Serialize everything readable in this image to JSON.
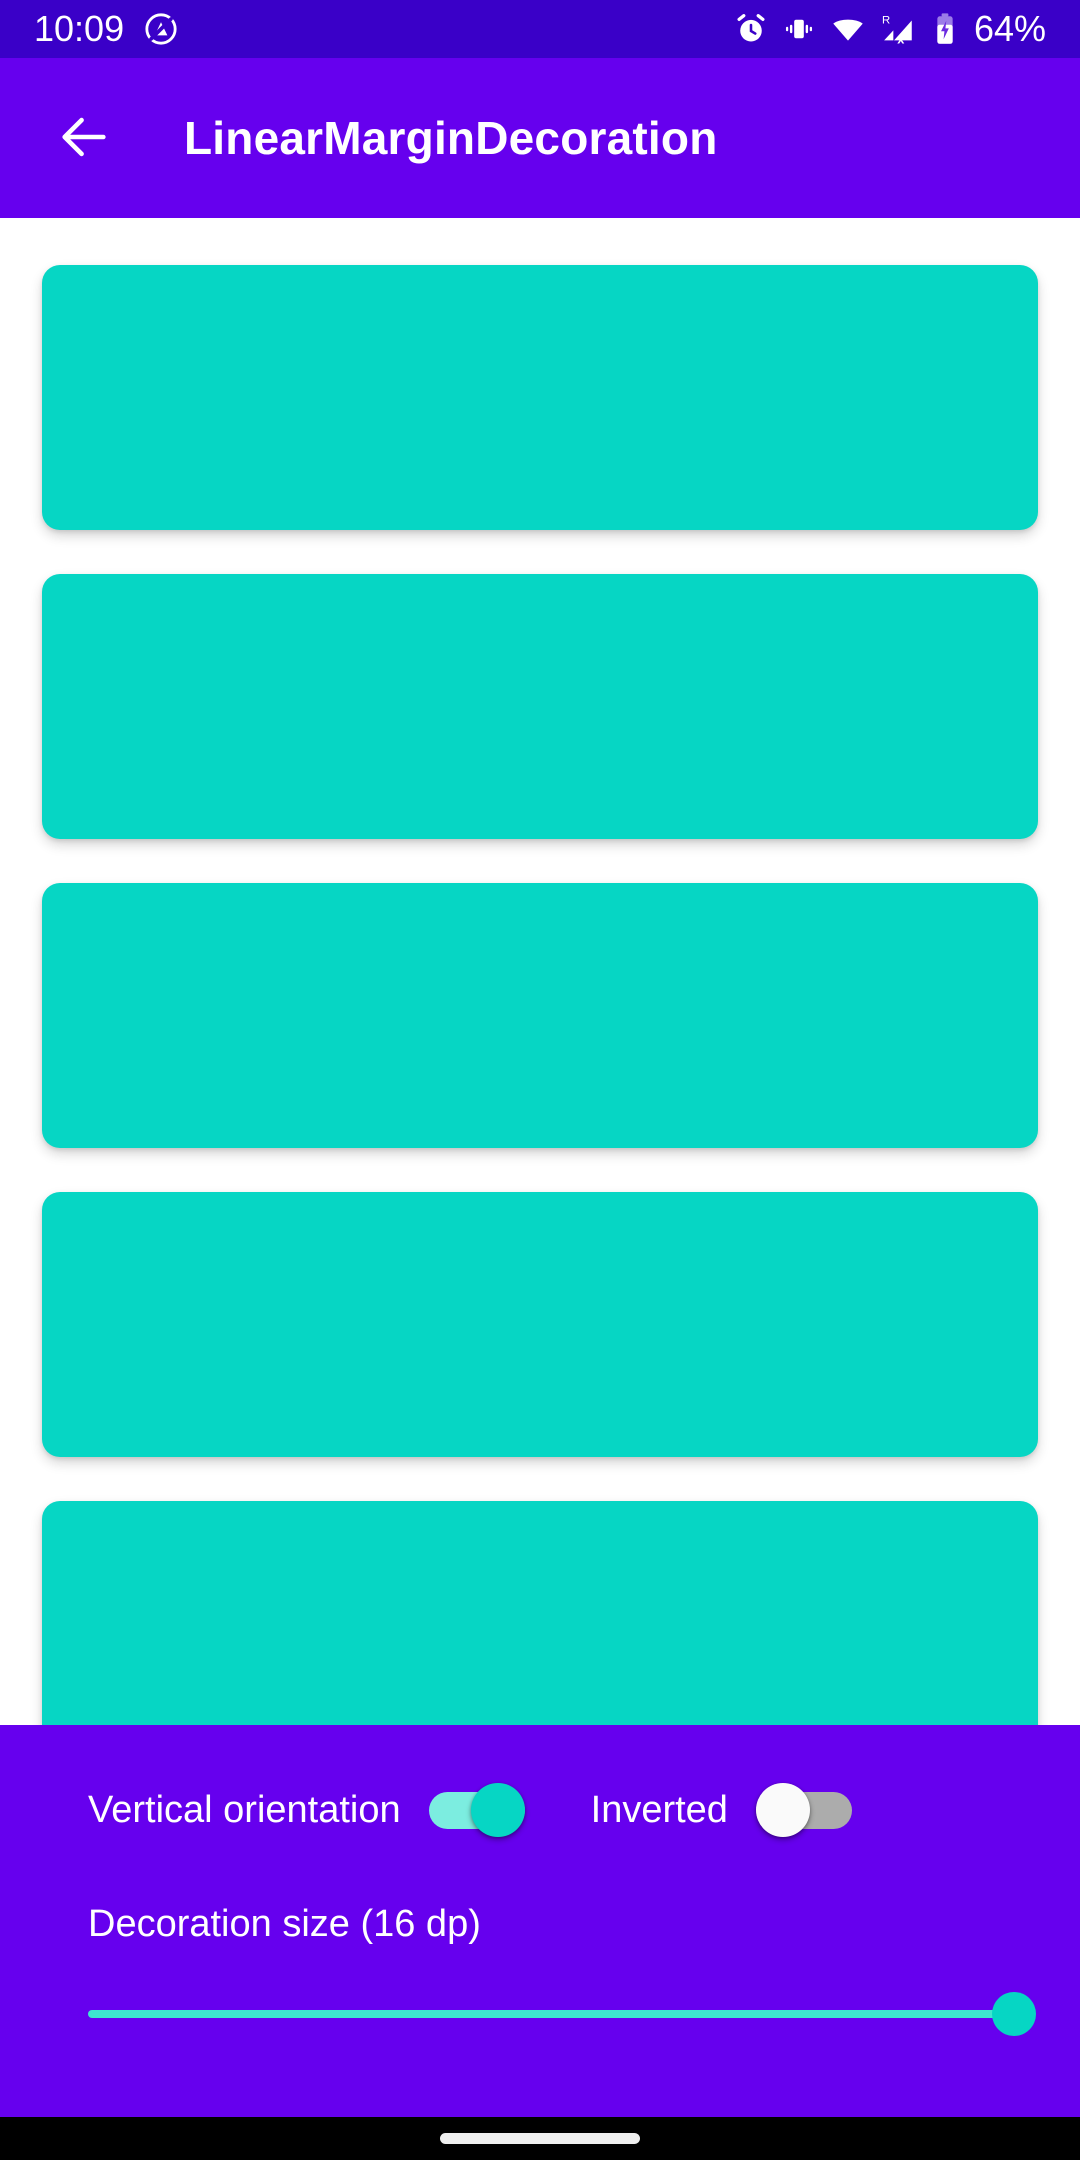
{
  "status_bar": {
    "time": "10:09",
    "battery_text": "64%",
    "background_color": "#3A00C8",
    "icons": [
      {
        "name": "do-not-disturb-icon",
        "label": "do not disturb"
      },
      {
        "name": "alarm-clock-icon",
        "label": "alarm set"
      },
      {
        "name": "vibrate-icon",
        "label": "ringer vibrate"
      },
      {
        "name": "wifi-icon",
        "label": "wifi connected"
      },
      {
        "name": "roaming-no-signal-icon",
        "label": "R signal x"
      },
      {
        "name": "battery-charging-icon",
        "label": "battery charging"
      }
    ],
    "roaming_letter": "R"
  },
  "app_bar": {
    "title": "LinearMarginDecoration",
    "back_icon": "arrow-left-icon",
    "background_color": "#6600EE"
  },
  "list": {
    "card_color": "#06D6C4",
    "background_color": "#FFFFFF",
    "items": [
      {
        "id": "card-1"
      },
      {
        "id": "card-2"
      },
      {
        "id": "card-3"
      },
      {
        "id": "card-4"
      },
      {
        "id": "card-5"
      },
      {
        "id": "card-6"
      }
    ]
  },
  "controls": {
    "background_color": "#6600EE",
    "vertical_orientation": {
      "label": "Vertical orientation",
      "state": "on",
      "thumb_color": "#06D6C4",
      "track_color": "#7CEDE0"
    },
    "inverted": {
      "label": "Inverted",
      "state": "off",
      "thumb_color": "#FAFAFA",
      "track_color": "#ACACAC"
    },
    "decoration_size": {
      "label": "Decoration size (16 dp)",
      "value": 16,
      "unit": "dp",
      "slider_position_percent": 100,
      "track_color": "#3EE6CF",
      "thumb_color": "#06D6C4"
    }
  },
  "nav_bar": {
    "background_color": "#000000",
    "gesture_pill_color": "#EFEFEF"
  }
}
